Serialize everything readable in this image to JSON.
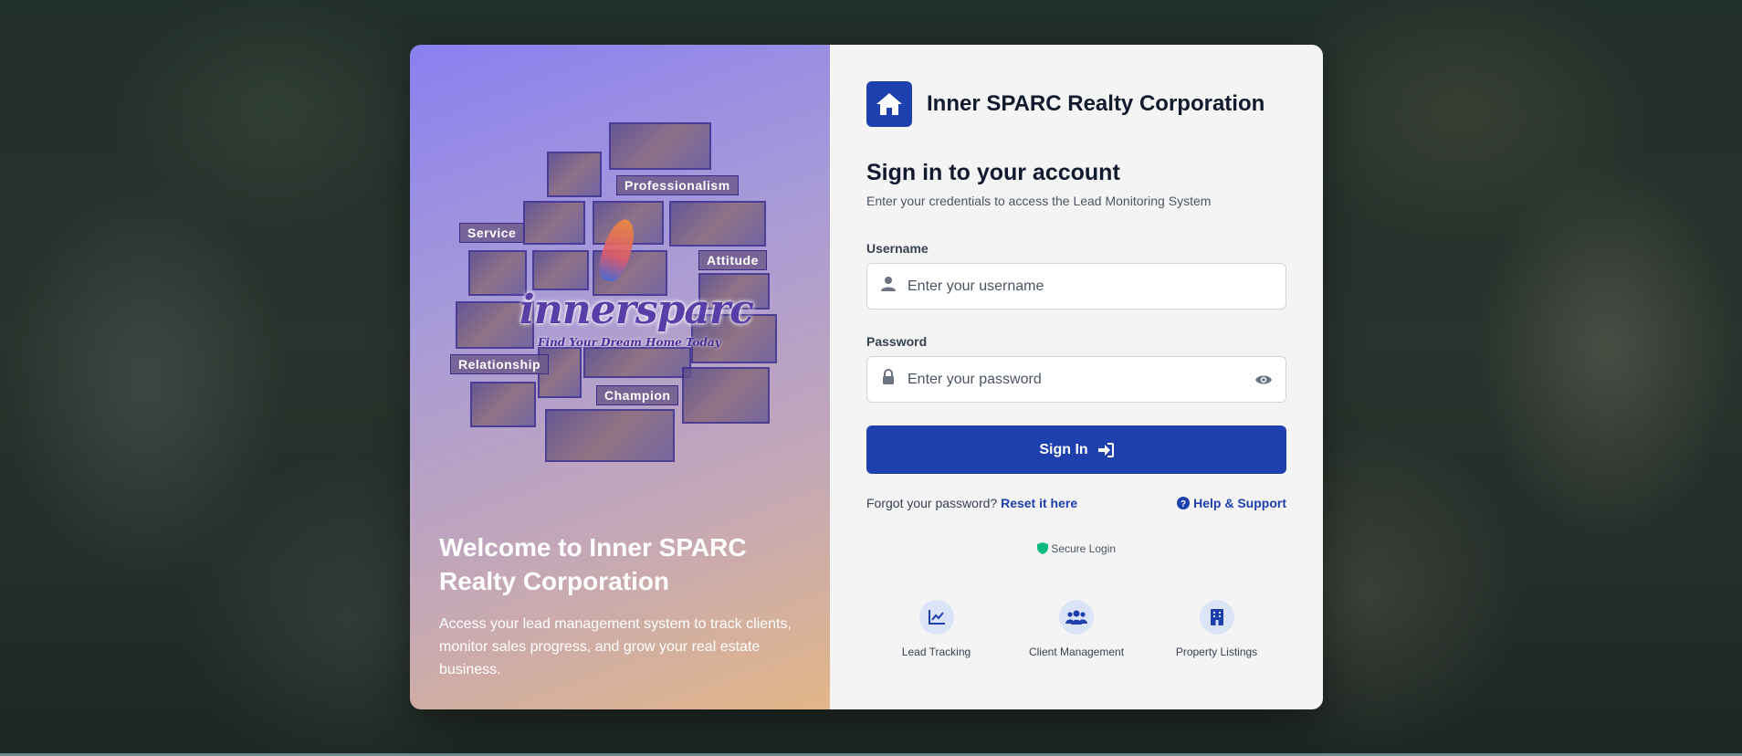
{
  "colors": {
    "brand": "#1e40af",
    "panel_bg": "#f4f4f4",
    "gradient_start": "#8a7ff0",
    "gradient_end": "#e2b687",
    "secure_green": "#10b981"
  },
  "hero": {
    "collage_tags": [
      "Professionalism",
      "Service",
      "Attitude",
      "Relationship",
      "Champion"
    ],
    "logo_text": "innersparc",
    "logo_tagline": "Find Your Dream Home Today",
    "welcome_title": "Welcome to Inner SPARC Realty Corporation",
    "welcome_desc": "Access your lead management system to track clients, monitor sales progress, and grow your real estate business."
  },
  "brand": {
    "icon": "home-icon",
    "name": "Inner SPARC Realty Corporation"
  },
  "form": {
    "title": "Sign in to your account",
    "subtitle": "Enter your credentials to access the Lead Monitoring System",
    "username": {
      "label": "Username",
      "placeholder": "Enter your username",
      "value": "",
      "icon": "user-icon"
    },
    "password": {
      "label": "Password",
      "placeholder": "Enter your password",
      "value": "",
      "icon": "lock-icon",
      "toggle_icon": "eye-icon"
    },
    "submit_label": "Sign In",
    "submit_icon": "sign-in-icon"
  },
  "links": {
    "forgot_text": "Forgot your password?",
    "reset_label": "Reset it here",
    "help_label": "Help & Support",
    "help_icon": "question-circle-icon"
  },
  "secure": {
    "label": "Secure Login",
    "icon": "shield-icon"
  },
  "features": [
    {
      "label": "Lead Tracking",
      "icon": "chart-line-icon"
    },
    {
      "label": "Client Management",
      "icon": "users-icon"
    },
    {
      "label": "Property Listings",
      "icon": "building-icon"
    }
  ]
}
